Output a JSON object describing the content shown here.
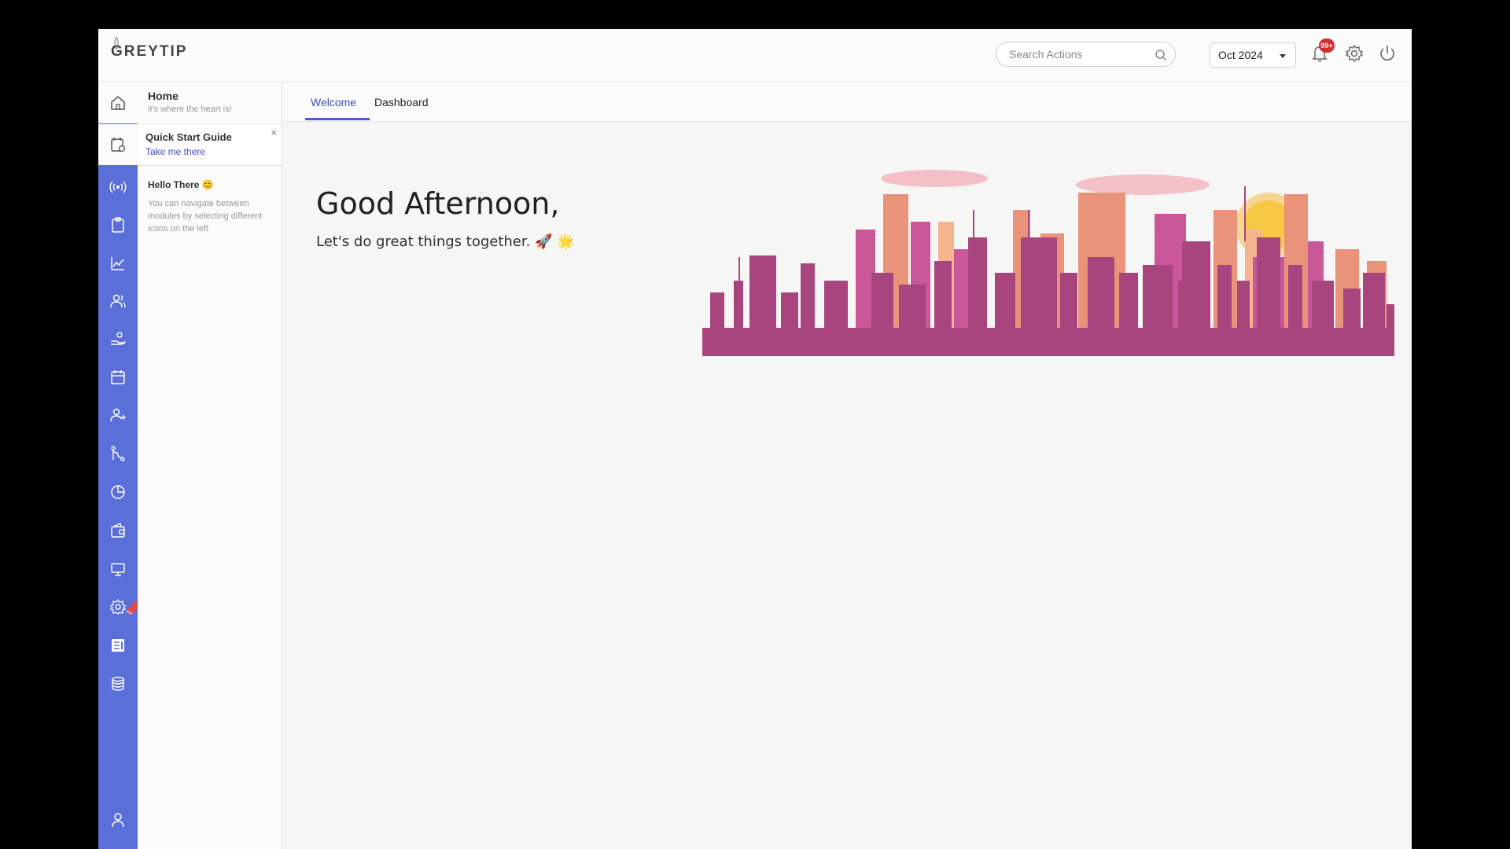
{
  "header": {
    "logo_text": "GREYTIP",
    "search_placeholder": "Search Actions",
    "month_value": "Oct 2024",
    "notification_badge": "99+"
  },
  "sidebar": {
    "home": {
      "title": "Home",
      "subtitle": "it's where the heart is!"
    },
    "quick_start": {
      "title": "Quick Start Guide",
      "link": "Take me there",
      "close": "×"
    },
    "hello": {
      "title": "Hello There 😊",
      "body": "You can navigate between modules by selecting different icons on the left"
    },
    "rail_icons": [
      "home-icon",
      "checklist-icon",
      "broadcast-icon",
      "clipboard-icon",
      "chart-line-icon",
      "users-icon",
      "hand-coin-icon",
      "calendar-icon",
      "user-plus-icon",
      "workflow-icon",
      "pie-chart-icon",
      "wallet-icon",
      "monitor-icon",
      "gear-icon",
      "document-icon",
      "database-icon",
      "user-icon"
    ]
  },
  "tabs": [
    {
      "label": "Welcome",
      "active": true
    },
    {
      "label": "Dashboard",
      "active": false
    }
  ],
  "welcome": {
    "greeting": "Good Afternoon,",
    "tagline": "Let's do great things together. 🚀 🌟"
  },
  "colors": {
    "rail": "#5b6fd8",
    "accent": "#3a4fc0",
    "badge": "#d0312d"
  }
}
